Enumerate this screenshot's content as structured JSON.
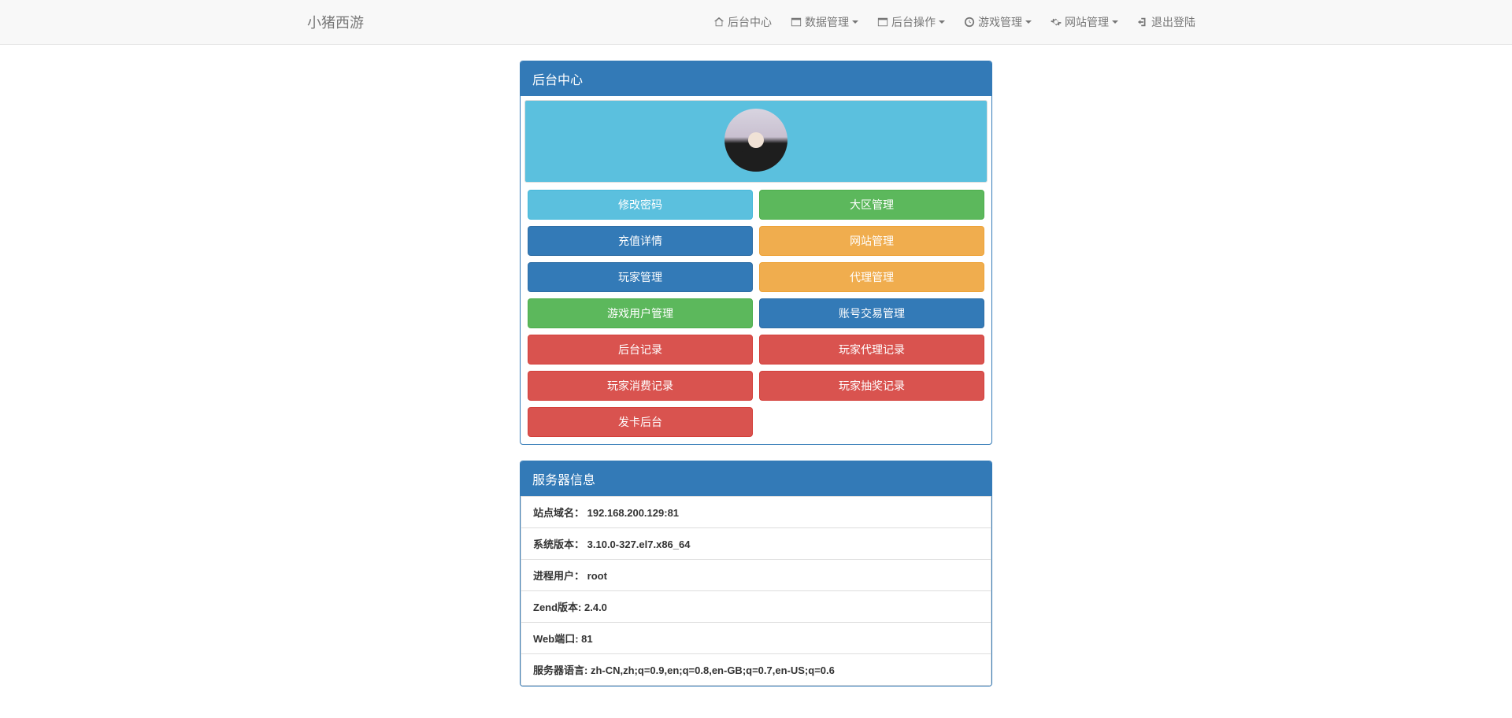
{
  "brand": "小猪西游",
  "nav": {
    "home": "后台中心",
    "data": "数据管理",
    "ops": "后台操作",
    "game": "游戏管理",
    "site": "网站管理",
    "logout": "退出登陆"
  },
  "panel1": {
    "title": "后台中心",
    "buttons": {
      "b0": "修改密码",
      "b1": "大区管理",
      "b2": "充值详情",
      "b3": "网站管理",
      "b4": "玩家管理",
      "b5": "代理管理",
      "b6": "游戏用户管理",
      "b7": "账号交易管理",
      "b8": "后台记录",
      "b9": "玩家代理记录",
      "b10": "玩家消费记录",
      "b11": "玩家抽奖记录",
      "b12": "发卡后台"
    }
  },
  "panel2": {
    "title": "服务器信息",
    "rows": {
      "r0": {
        "label": "站点域名：",
        "value": "192.168.200.129:81"
      },
      "r1": {
        "label": "系统版本：",
        "value": "3.10.0-327.el7.x86_64"
      },
      "r2": {
        "label": "进程用户：",
        "value": "root"
      },
      "r3": {
        "label": "Zend版本: ",
        "value": "2.4.0"
      },
      "r4": {
        "label": "Web端口: ",
        "value": "81"
      },
      "r5": {
        "label": "服务器语言: ",
        "value": "zh-CN,zh;q=0.9,en;q=0.8,en-GB;q=0.7,en-US;q=0.6"
      }
    }
  }
}
